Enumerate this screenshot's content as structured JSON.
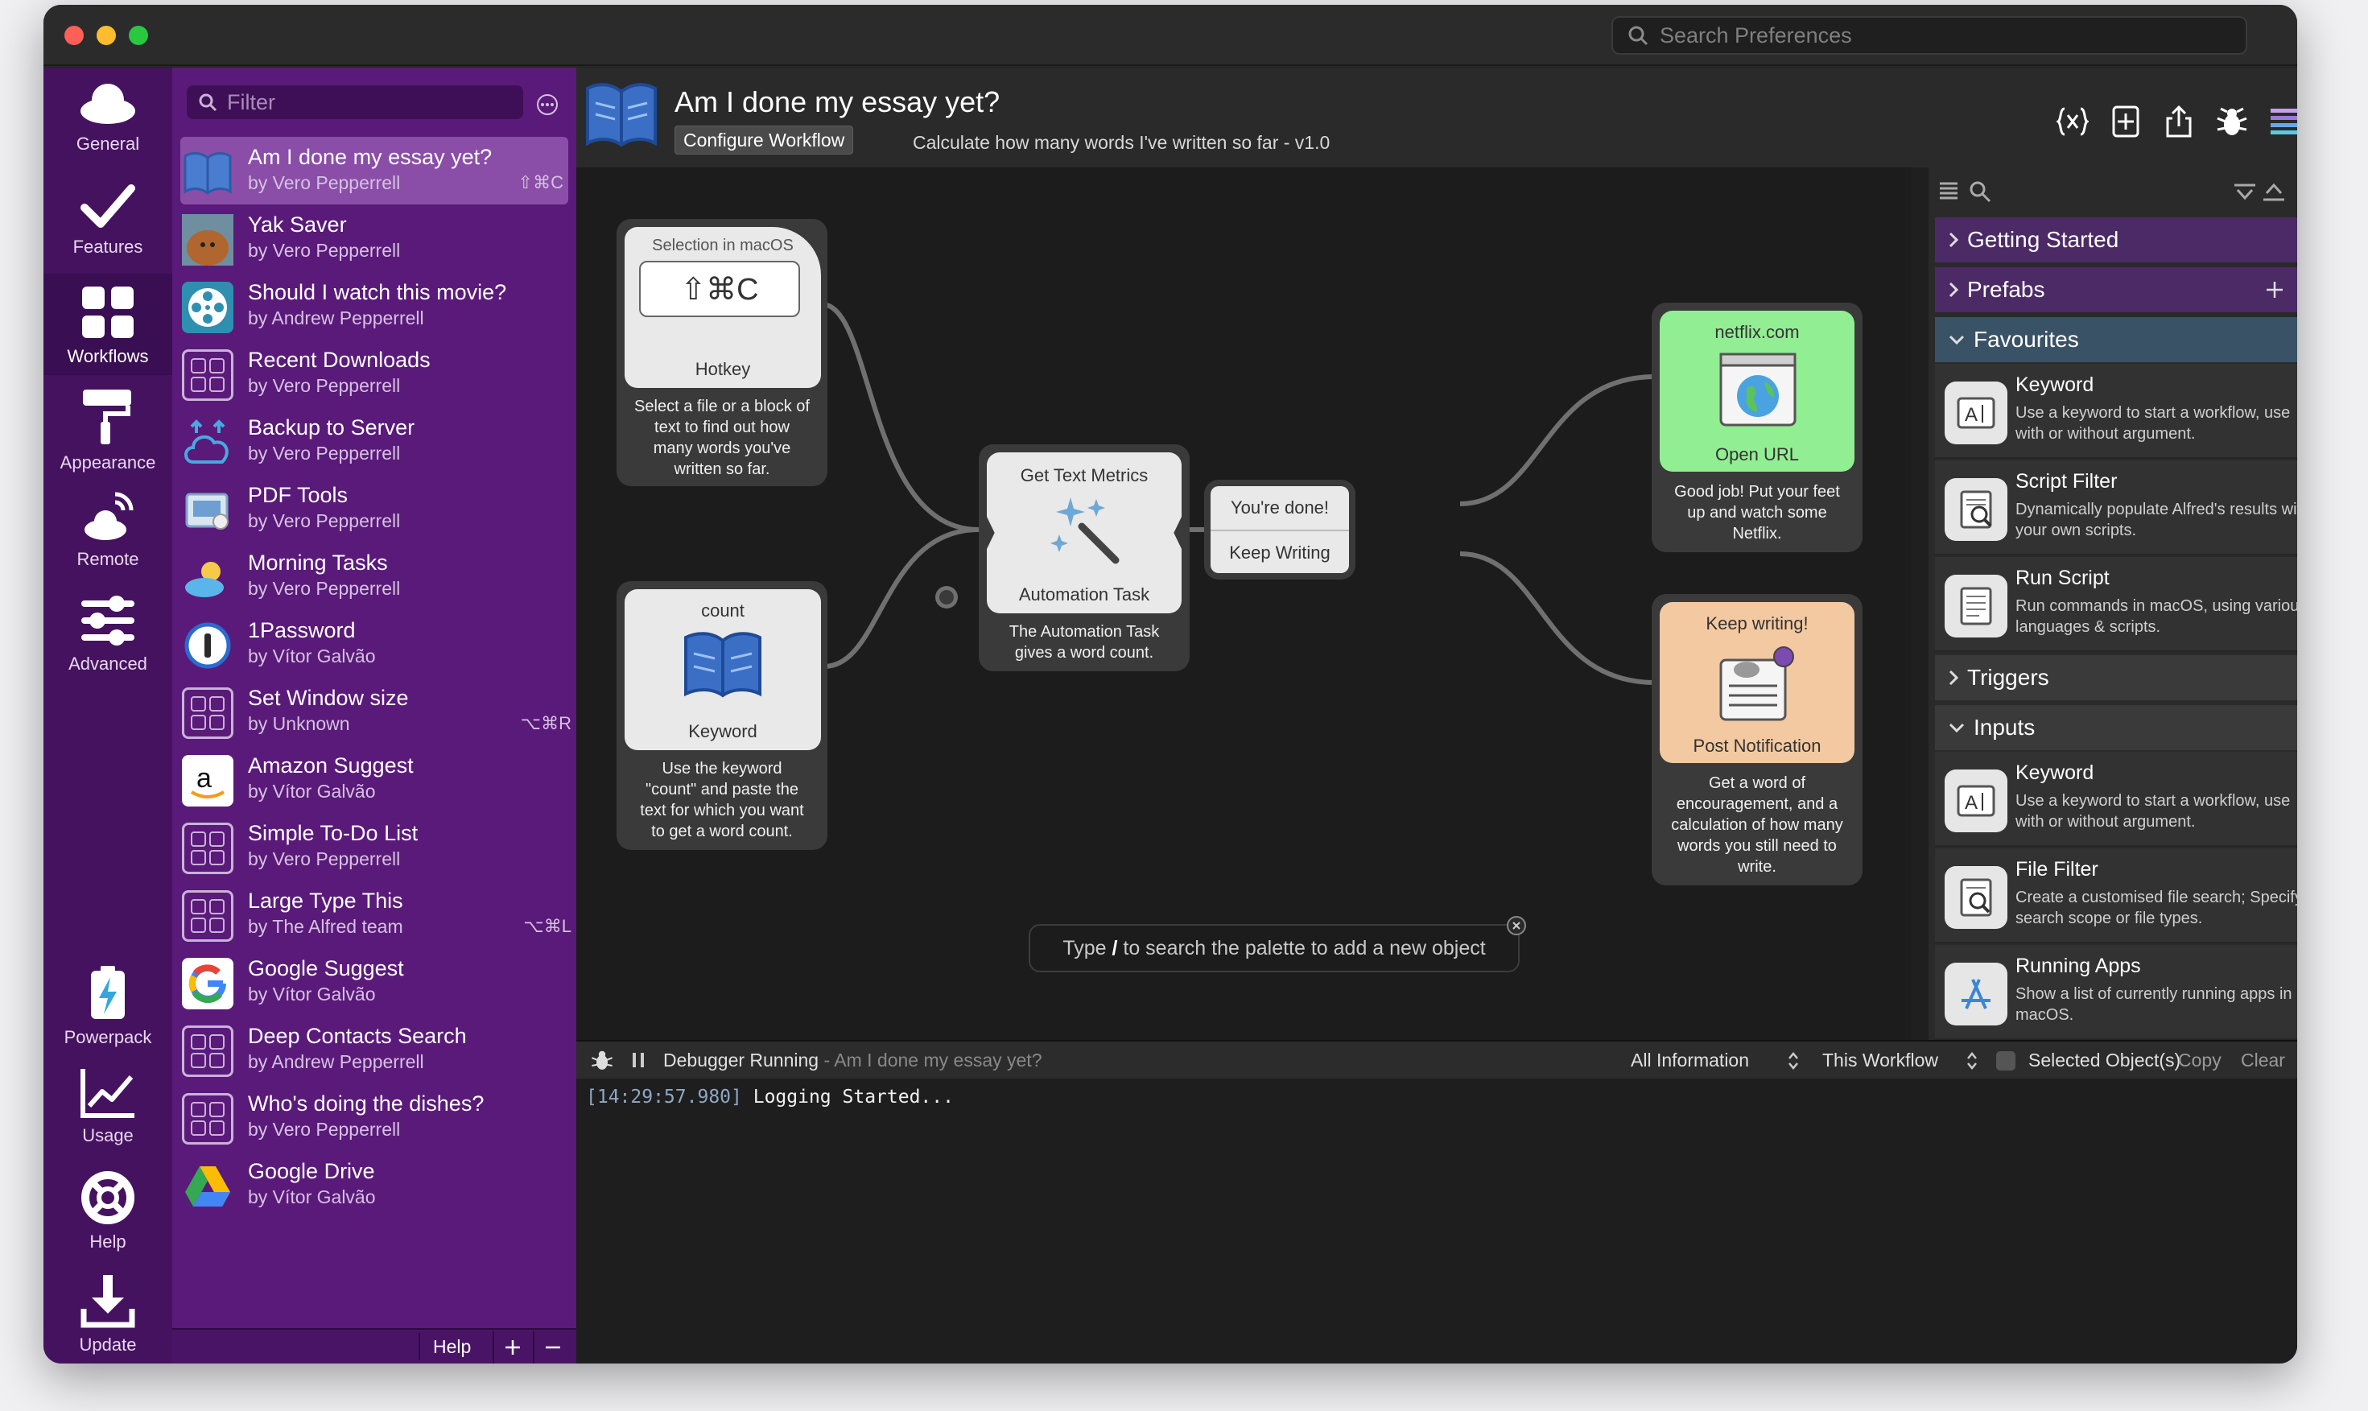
{
  "search": {
    "placeholder": "Search Preferences"
  },
  "nav": [
    {
      "label": "General",
      "icon": "cloud-icon"
    },
    {
      "label": "Features",
      "icon": "checkmark-icon"
    },
    {
      "label": "Workflows",
      "icon": "grid-icon"
    },
    {
      "label": "Appearance",
      "icon": "paint-roller-icon"
    },
    {
      "label": "Remote",
      "icon": "remote-icon"
    },
    {
      "label": "Advanced",
      "icon": "sliders-icon"
    },
    {
      "label": "Powerpack",
      "icon": "battery-bolt-icon"
    },
    {
      "label": "Usage",
      "icon": "chart-icon"
    },
    {
      "label": "Help",
      "icon": "lifebuoy-icon"
    },
    {
      "label": "Update",
      "icon": "download-icon"
    }
  ],
  "workflows": {
    "filter_placeholder": "Filter",
    "items": [
      {
        "name": "Am I done my essay yet?",
        "by": "by Vero Pepperrell",
        "hotkey": "⇧⌘C",
        "icon": "book-icon"
      },
      {
        "name": "Yak Saver",
        "by": "by Vero Pepperrell",
        "hotkey": "",
        "icon": "yak-photo-icon"
      },
      {
        "name": "Should I watch this movie?",
        "by": "by Andrew Pepperrell",
        "hotkey": "",
        "icon": "film-reel-icon"
      },
      {
        "name": "Recent Downloads",
        "by": "by Vero Pepperrell",
        "hotkey": "",
        "icon": "placeholder-grid-icon"
      },
      {
        "name": "Backup to Server",
        "by": "by Vero Pepperrell",
        "hotkey": "",
        "icon": "cloud-sync-icon"
      },
      {
        "name": "PDF Tools",
        "by": "by Vero Pepperrell",
        "hotkey": "",
        "icon": "pdf-icon"
      },
      {
        "name": "Morning Tasks",
        "by": "by Vero Pepperrell",
        "hotkey": "",
        "icon": "sun-cloud-icon"
      },
      {
        "name": "1Password",
        "by": "by Vítor Galvão",
        "hotkey": "",
        "icon": "1password-icon"
      },
      {
        "name": "Set Window size",
        "by": "by Unknown",
        "hotkey": "⌥⌘R",
        "icon": "placeholder-grid-icon"
      },
      {
        "name": "Amazon Suggest",
        "by": "by Vítor Galvão",
        "hotkey": "",
        "icon": "amazon-icon"
      },
      {
        "name": "Simple To-Do List",
        "by": "by Vero Pepperrell",
        "hotkey": "",
        "icon": "placeholder-grid-icon"
      },
      {
        "name": "Large Type This",
        "by": "by The Alfred team",
        "hotkey": "⌥⌘L",
        "icon": "placeholder-grid-icon"
      },
      {
        "name": "Google Suggest",
        "by": "by Vítor Galvão",
        "hotkey": "",
        "icon": "google-icon"
      },
      {
        "name": "Deep Contacts Search",
        "by": "by Andrew Pepperrell",
        "hotkey": "",
        "icon": "placeholder-grid-icon"
      },
      {
        "name": "Who's doing the dishes?",
        "by": "by Vero Pepperrell",
        "hotkey": "",
        "icon": "placeholder-grid-icon"
      },
      {
        "name": "Google Drive",
        "by": "by Vítor Galvão",
        "hotkey": "",
        "icon": "google-drive-icon"
      }
    ],
    "help_label": "Help"
  },
  "header": {
    "title": "Am I done my essay yet?",
    "configure_label": "Configure Workflow",
    "description": "Calculate how many words I've written so far - v1.0"
  },
  "nodes": {
    "hotkey": {
      "top_label": "Selection in macOS",
      "combo": "⇧⌘C",
      "type": "Hotkey",
      "caption": [
        "Select a file or a block of",
        "text to find out how",
        "many words you've",
        "written so far."
      ]
    },
    "keyword": {
      "top_label": "count",
      "type": "Keyword",
      "caption": [
        "Use the keyword",
        "\"count\" and paste the",
        "text for which you want",
        "to get a word count."
      ]
    },
    "automation": {
      "top_label": "Get Text Metrics",
      "type": "Automation Task",
      "caption": [
        "The Automation Task",
        "gives a word count."
      ]
    },
    "conditional": {
      "option1": "You're done!",
      "option2": "Keep Writing"
    },
    "openurl": {
      "top_label": "netflix.com",
      "type": "Open URL",
      "caption": [
        "Good job! Put your feet",
        "up and watch some",
        "Netflix."
      ]
    },
    "notify": {
      "top_label": "Keep writing!",
      "type": "Post Notification",
      "caption": [
        "Get a word of",
        "encouragement, and a",
        "calculation of how many",
        "words you still need to",
        "write."
      ]
    }
  },
  "palette": {
    "prefix": "Type ",
    "slash": "/",
    "suffix": " to search the palette to add a new object"
  },
  "rpanel": {
    "sections": {
      "getting_started": "Getting Started",
      "prefabs": "Prefabs",
      "favourites": "Favourites",
      "triggers": "Triggers",
      "inputs": "Inputs"
    },
    "favourites": [
      {
        "name": "Keyword",
        "desc": "Use a keyword to start a workflow, use with or without argument.",
        "starred": true
      },
      {
        "name": "Script Filter",
        "desc": "Dynamically populate Alfred's results with your own scripts.",
        "starred": true
      },
      {
        "name": "Run Script",
        "desc": "Run commands in macOS, using various languages & scripts.",
        "starred": true
      }
    ],
    "inputs": [
      {
        "name": "Keyword",
        "desc": "Use a keyword to start a workflow, use with or without argument.",
        "starred": true
      },
      {
        "name": "File Filter",
        "desc": "Create a customised file search; Specify search scope or file types.",
        "starred": false
      },
      {
        "name": "Running Apps",
        "desc": "Show a list of currently running apps in macOS.",
        "starred": false
      }
    ]
  },
  "debugger": {
    "status": "Debugger Running",
    "workflow": " - Am I done my essay yet?",
    "info_select": "All Information",
    "scope_select": "This Workflow",
    "selected_label": "Selected Object(s)",
    "copy_label": "Copy",
    "clear_label": "Clear",
    "log_time": "[14:29:57.980]",
    "log_msg": " Logging Started..."
  },
  "colors": {
    "accent": "#45125f",
    "star": "#3fa9d8",
    "green_node": "#92ee92",
    "orange_node": "#f3c9a1"
  }
}
